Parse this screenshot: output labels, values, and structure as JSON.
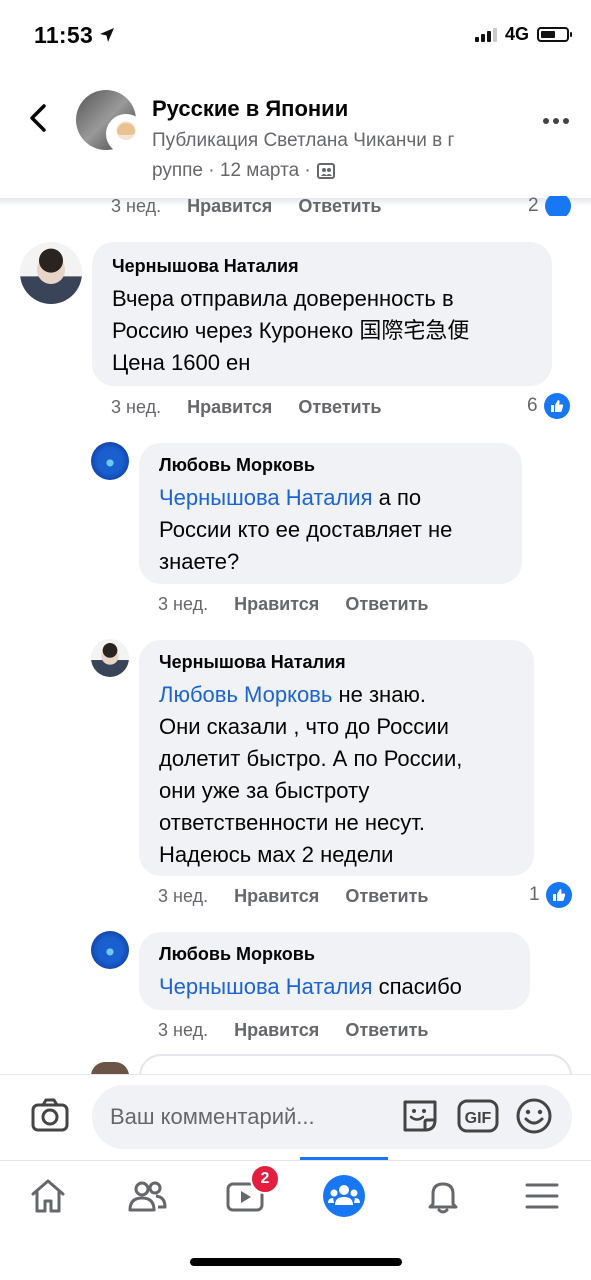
{
  "status_bar": {
    "time": "11:53",
    "network": "4G"
  },
  "header": {
    "title": "Русские в Японии",
    "subtitle_line1": "Публикация Светлана Чиканчи в г",
    "subtitle_line2": "руппе · 12 марта ·"
  },
  "partial_meta": {
    "time": "3 нед.",
    "like_label": "Нравится",
    "reply_label": "Ответить",
    "likes": "2"
  },
  "comments": [
    {
      "author": "Чернышова Наталия",
      "lines": [
        "Вчера отправила доверенность в",
        "Россию через Куронеко  国際宅急便",
        "Цена 1600 ен"
      ],
      "time": "3 нед.",
      "like_label": "Нравится",
      "reply_label": "Ответить",
      "likes": "6"
    },
    {
      "author": "Любовь Морковь",
      "mention": "Чернышова Наталия",
      "first_line_rest": " а по",
      "lines": [
        "России кто ее доставляет не",
        "знаете?"
      ],
      "time": "3 нед.",
      "like_label": "Нравится",
      "reply_label": "Ответить"
    },
    {
      "author": "Чернышова Наталия",
      "mention": "Любовь Морковь",
      "first_line_rest": "  не знаю.",
      "lines": [
        "Они сказали , что до России",
        "долетит быстро. А по России,",
        "они уже за быстроту",
        "ответственности не несут.",
        "Надеюсь мах 2 недели"
      ],
      "time": "3 нед.",
      "like_label": "Нравится",
      "reply_label": "Ответить",
      "likes": "1"
    },
    {
      "author": "Любовь Морковь",
      "mention": "Чернышова Наталия",
      "first_line_rest": " спасибо",
      "time": "3 нед.",
      "like_label": "Нравится",
      "reply_label": "Ответить"
    }
  ],
  "comment_bar": {
    "placeholder": "Ваш комментарий..."
  },
  "tab_bar": {
    "watch_badge": "2"
  },
  "colors": {
    "accent": "#1877f2",
    "mention": "#1b63d6",
    "badge": "#e41e3f",
    "bubble": "#f0f2f5"
  }
}
